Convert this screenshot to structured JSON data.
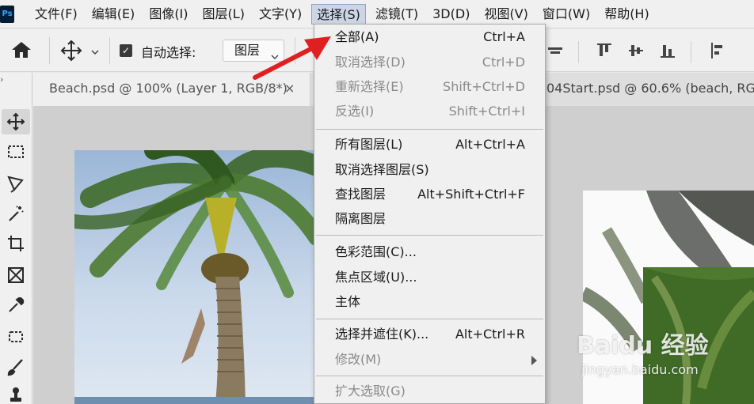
{
  "app": {
    "icon_label": "Ps"
  },
  "menubar": {
    "items": [
      "文件(F)",
      "编辑(E)",
      "图像(I)",
      "图层(L)",
      "文字(Y)",
      "选择(S)",
      "滤镜(T)",
      "3D(D)",
      "视图(V)",
      "窗口(W)",
      "帮助(H)"
    ],
    "active": "选择(S)"
  },
  "options": {
    "auto_select_label": "自动选择:",
    "auto_select_checked": true,
    "target_value": "图层"
  },
  "tabs": {
    "tab1_title": "Beach.psd @ 100% (Layer 1, RGB/8*)",
    "tab1_close": "×",
    "tab2_title": "04Start.psd @ 60.6% (beach, RGB/"
  },
  "select_menu": {
    "items": [
      {
        "label": "全部(A)",
        "shortcut": "Ctrl+A",
        "enabled": true
      },
      {
        "label": "取消选择(D)",
        "shortcut": "Ctrl+D",
        "enabled": false
      },
      {
        "label": "重新选择(E)",
        "shortcut": "Shift+Ctrl+D",
        "enabled": false
      },
      {
        "label": "反选(I)",
        "shortcut": "Shift+Ctrl+I",
        "enabled": false
      },
      {
        "label": "所有图层(L)",
        "shortcut": "Alt+Ctrl+A",
        "enabled": true
      },
      {
        "label": "取消选择图层(S)",
        "shortcut": "",
        "enabled": true
      },
      {
        "label": "查找图层",
        "shortcut": "Alt+Shift+Ctrl+F",
        "enabled": true
      },
      {
        "label": "隔离图层",
        "shortcut": "",
        "enabled": true
      },
      {
        "label": "色彩范围(C)...",
        "shortcut": "",
        "enabled": true
      },
      {
        "label": "焦点区域(U)...",
        "shortcut": "",
        "enabled": true
      },
      {
        "label": "主体",
        "shortcut": "",
        "enabled": true
      },
      {
        "label": "选择并遮住(K)...",
        "shortcut": "Alt+Ctrl+R",
        "enabled": true
      },
      {
        "label": "修改(M)",
        "shortcut": "",
        "enabled": false,
        "has_submenu": true
      },
      {
        "label": "扩大选取(G)",
        "shortcut": "",
        "enabled": false
      }
    ]
  },
  "watermark": {
    "brand": "Baidu 经验",
    "url": "jingyan.baidu.com"
  },
  "colors": {
    "annotation_arrow": "#e02020",
    "menu_highlight": "#ccd6e6"
  }
}
